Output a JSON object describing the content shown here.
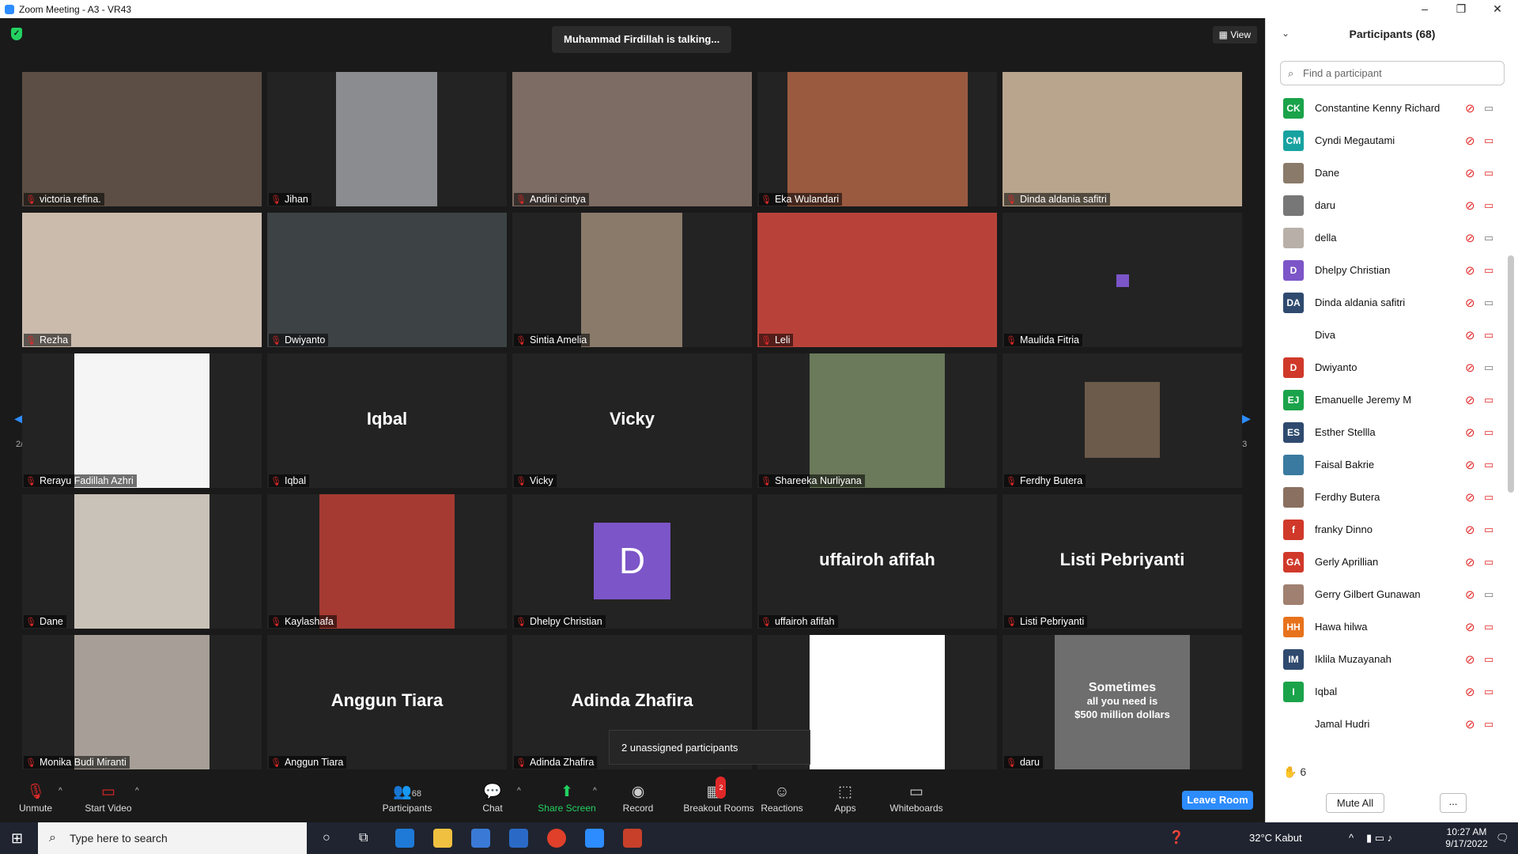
{
  "window": {
    "title": "Zoom Meeting - A3 - VR43"
  },
  "meeting": {
    "talking_banner": "Muhammad Firdillah is talking...",
    "view_label": "View",
    "page_indicator_left": "2/3",
    "page_indicator_right": "2/3",
    "unassigned": "2 unassigned participants"
  },
  "tiles": [
    {
      "name": "victoria refina.",
      "type": "video",
      "color": "#5c4e44"
    },
    {
      "name": "Jihan",
      "type": "video-narrow",
      "color": "#8a8c90"
    },
    {
      "name": "Andini cintya",
      "type": "video",
      "color": "#7d6c63"
    },
    {
      "name": "Eka Wulandari",
      "type": "video-mid",
      "color": "#9a5a40"
    },
    {
      "name": "Dinda aldania safitri",
      "type": "video",
      "color": "#b9a58d"
    },
    {
      "name": "Rezha",
      "type": "video",
      "color": "#cbbbad"
    },
    {
      "name": "Dwiyanto",
      "type": "video",
      "color": "#3d4244"
    },
    {
      "name": "Sintia Amelia",
      "type": "video-narrow",
      "color": "#8a7a6a"
    },
    {
      "name": "Leli",
      "type": "video",
      "color": "#b8423a"
    },
    {
      "name": "Maulida Fitria",
      "type": "tiny"
    },
    {
      "name": "Rerayu Fadillah Azhri",
      "type": "video-white",
      "color": "#f5f5f5"
    },
    {
      "name": "Iqbal",
      "type": "text",
      "big": "Iqbal"
    },
    {
      "name": "Vicky",
      "type": "text",
      "big": "Vicky"
    },
    {
      "name": "Shareeka Nurliyana",
      "type": "video-photo",
      "color": "#6b7a5a"
    },
    {
      "name": "Ferdhy Butera",
      "type": "photo-small",
      "color": "#6c5a4a"
    },
    {
      "name": "Dane",
      "type": "video-photo",
      "color": "#c9c2b8"
    },
    {
      "name": "Kaylashafa",
      "type": "video-photo",
      "color": "#a43a32"
    },
    {
      "name": "Dhelpy Christian",
      "type": "avatar",
      "big": "D"
    },
    {
      "name": "uffairoh afifah",
      "type": "text",
      "big": "uffairoh afifah"
    },
    {
      "name": "Listi Pebriyanti",
      "type": "text",
      "big": "Listi Pebriyanti"
    },
    {
      "name": "Monika Budi Miranti",
      "type": "video-photo",
      "color": "#a79f97"
    },
    {
      "name": "Anggun Tiara",
      "type": "text",
      "big": "Anggun Tiara"
    },
    {
      "name": "Adinda Zhafira",
      "type": "text",
      "big": "Adinda Zhafira"
    },
    {
      "name": "",
      "type": "video-white",
      "color": "#ffffff"
    },
    {
      "name": "daru",
      "type": "shirt",
      "color": "#6e6e6e",
      "shirt_lines": [
        "Sometimes",
        "all you need is",
        "$500 million dollars"
      ]
    }
  ],
  "toolbar": {
    "unmute": "Unmute",
    "start_video": "Start Video",
    "participants": "Participants",
    "participants_count": "68",
    "chat": "Chat",
    "share_screen": "Share Screen",
    "record": "Record",
    "breakout": "Breakout Rooms",
    "breakout_badge": "2",
    "reactions": "Reactions",
    "apps": "Apps",
    "whiteboards": "Whiteboards",
    "leave": "Leave Room"
  },
  "panel": {
    "title": "Participants (68)",
    "search_placeholder": "Find a participant",
    "raised_hands": "6",
    "mute_all": "Mute All",
    "more": "...",
    "participants": [
      {
        "initials": "CK",
        "name": "Constantine Kenny Richard",
        "color": "#1aa34a",
        "cam": "on"
      },
      {
        "initials": "CM",
        "name": "Cyndi Megautami",
        "color": "#17a2a0",
        "cam": "off"
      },
      {
        "initials": "",
        "name": "Dane",
        "color": "#8a7a6a",
        "cam": "off"
      },
      {
        "initials": "",
        "name": "daru",
        "color": "#777777",
        "cam": "off"
      },
      {
        "initials": "",
        "name": "della",
        "color": "#b8b0a8",
        "cam": "on"
      },
      {
        "initials": "D",
        "name": "Dhelpy Christian",
        "color": "#7c55c8",
        "cam": "off"
      },
      {
        "initials": "DA",
        "name": "Dinda aldania safitri",
        "color": "#2f4a6e",
        "cam": "on"
      },
      {
        "initials": "",
        "name": "Diva",
        "color": "#ffffff",
        "cam": "off"
      },
      {
        "initials": "D",
        "name": "Dwiyanto",
        "color": "#d0392a",
        "cam": "on"
      },
      {
        "initials": "EJ",
        "name": "Emanuelle Jeremy M",
        "color": "#1aa34a",
        "cam": "off"
      },
      {
        "initials": "ES",
        "name": "Esther Stellla",
        "color": "#2f4a6e",
        "cam": "off"
      },
      {
        "initials": "",
        "name": "Faisal Bakrie",
        "color": "#3a7aa0",
        "cam": "off"
      },
      {
        "initials": "",
        "name": "Ferdhy Butera",
        "color": "#8a7060",
        "cam": "off"
      },
      {
        "initials": "f",
        "name": "franky Dinno",
        "color": "#d0392a",
        "cam": "off"
      },
      {
        "initials": "GA",
        "name": "Gerly Aprillian",
        "color": "#d0392a",
        "cam": "off"
      },
      {
        "initials": "",
        "name": "Gerry Gilbert Gunawan",
        "color": "#a08070",
        "cam": "on"
      },
      {
        "initials": "HH",
        "name": "Hawa hilwa",
        "color": "#e8721c",
        "cam": "off"
      },
      {
        "initials": "IM",
        "name": "Iklila Muzayanah",
        "color": "#2f4a6e",
        "cam": "off"
      },
      {
        "initials": "I",
        "name": "Iqbal",
        "color": "#1aa34a",
        "cam": "off"
      },
      {
        "initials": "",
        "name": "Jamal Hudri",
        "color": "#ffffff",
        "cam": "off"
      }
    ]
  },
  "taskbar": {
    "search_placeholder": "Type here to search",
    "weather": "32°C  Kabut",
    "time": "10:27 AM",
    "date": "9/17/2022",
    "notif_count": "2"
  },
  "colors": {
    "accent": "#2d8cff",
    "muted_red": "#e02828",
    "stage_bg": "#1a1a1a"
  }
}
